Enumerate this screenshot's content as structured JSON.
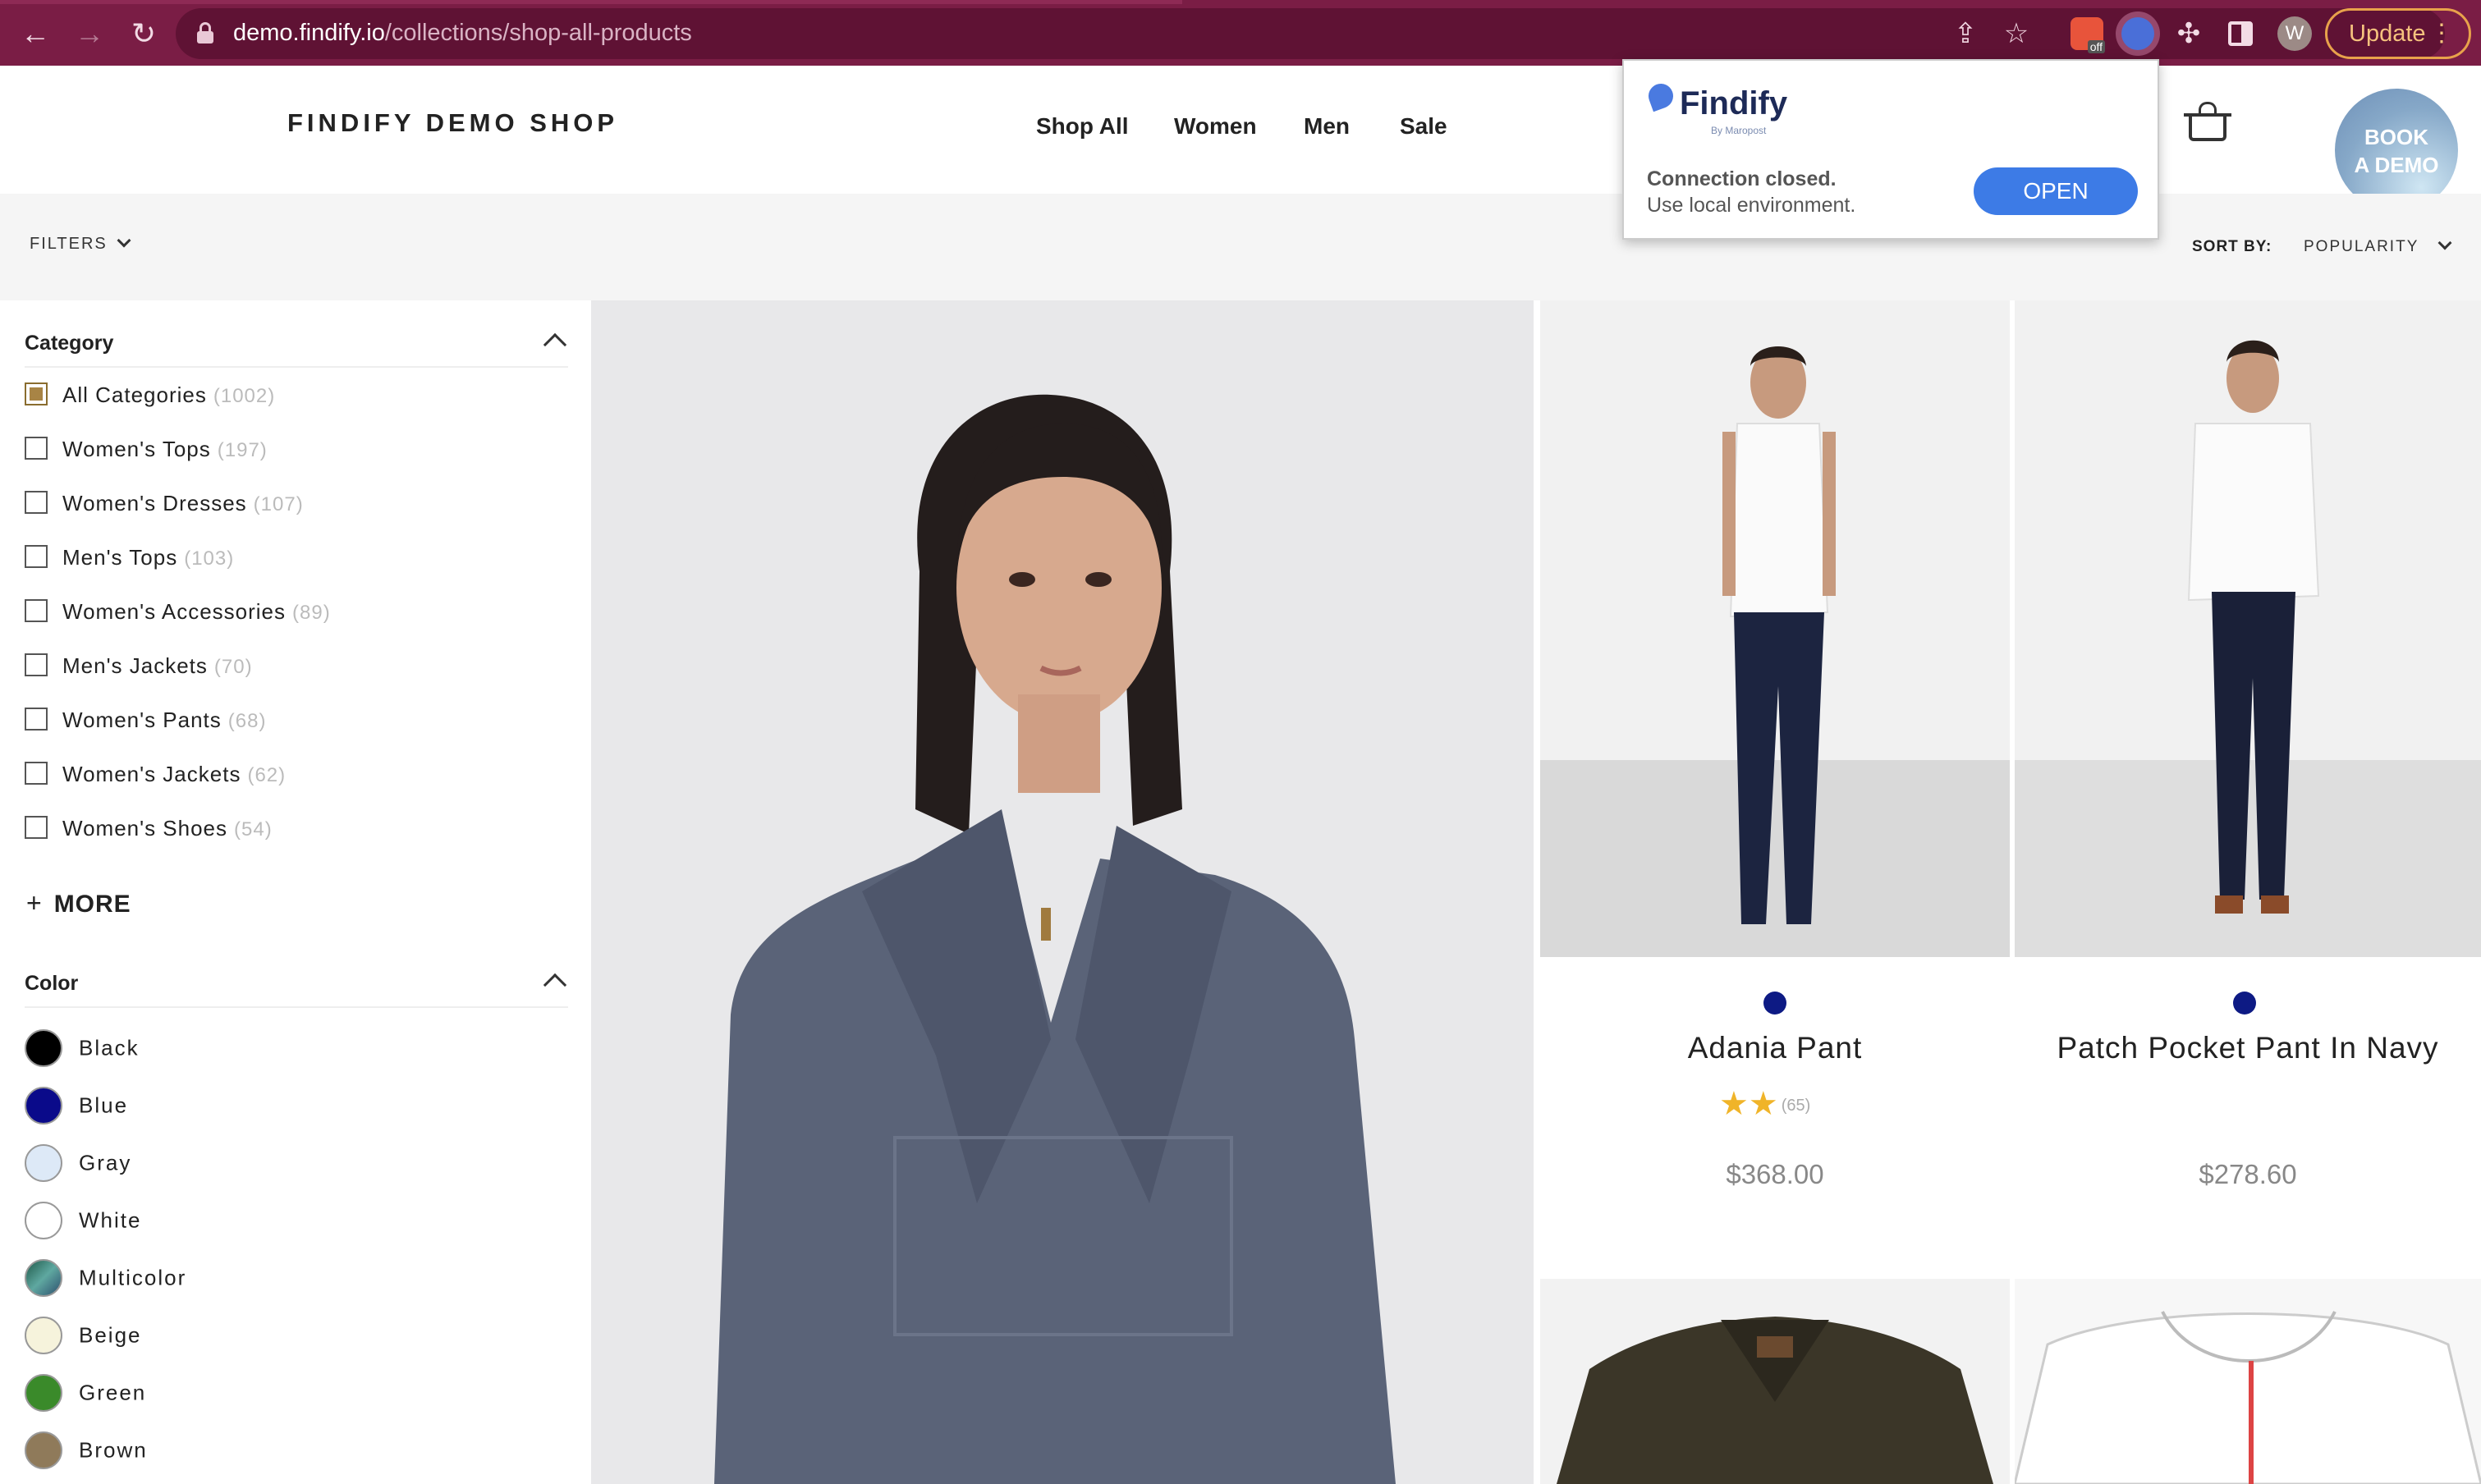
{
  "browser": {
    "url_host": "demo.findify.io",
    "url_path": "/collections/shop-all-products",
    "avatar_letter": "W",
    "update_label": "Update",
    "ext_off_badge": "off",
    "icons": [
      "back-icon",
      "forward-icon",
      "reload-icon",
      "lock-icon",
      "share-icon",
      "star-icon",
      "puzzle-icon",
      "side-panel-icon",
      "kebab-menu-icon"
    ]
  },
  "header": {
    "logo": "FINDIFY DEMO SHOP",
    "nav": [
      "Shop All",
      "Women",
      "Men",
      "Sale"
    ],
    "book_demo_line1": "BOOK",
    "book_demo_line2": "A DEMO"
  },
  "toolbar": {
    "filters_label": "FILTERS",
    "sort_label": "SORT BY:",
    "sort_value": "POPULARITY"
  },
  "popup": {
    "brand": "Findify",
    "brand_sub": "By Maropost",
    "message_title": "Connection closed.",
    "message_body": "Use local environment.",
    "open_label": "OPEN"
  },
  "filters": {
    "category_title": "Category",
    "categories": [
      {
        "label": "All Categories",
        "count": "(1002)",
        "checked": true
      },
      {
        "label": "Women's Tops",
        "count": "(197)",
        "checked": false
      },
      {
        "label": "Women's Dresses",
        "count": "(107)",
        "checked": false
      },
      {
        "label": "Men's Tops",
        "count": "(103)",
        "checked": false
      },
      {
        "label": "Women's Accessories",
        "count": "(89)",
        "checked": false
      },
      {
        "label": "Men's Jackets",
        "count": "(70)",
        "checked": false
      },
      {
        "label": "Women's Pants",
        "count": "(68)",
        "checked": false
      },
      {
        "label": "Women's Jackets",
        "count": "(62)",
        "checked": false
      },
      {
        "label": "Women's Shoes",
        "count": "(54)",
        "checked": false
      }
    ],
    "more_label": "MORE",
    "color_title": "Color",
    "colors": [
      {
        "label": "Black",
        "hex": "#000000"
      },
      {
        "label": "Blue",
        "hex": "#0a0a8a"
      },
      {
        "label": "Gray",
        "hex": "#dde9f7"
      },
      {
        "label": "White",
        "hex": "#ffffff"
      },
      {
        "label": "Multicolor",
        "hex": "#2f6e5c"
      },
      {
        "label": "Beige",
        "hex": "#f6f3dc"
      },
      {
        "label": "Green",
        "hex": "#3a8a2a"
      },
      {
        "label": "Brown",
        "hex": "#8f7a5a"
      }
    ]
  },
  "products": [
    {
      "title": "Adania Pant",
      "rating_stars": 2,
      "rating_count": "(65)",
      "price": "$368.00",
      "swatch": "#0d1a84"
    },
    {
      "title": "Patch Pocket Pant In Navy",
      "rating_stars": 0,
      "rating_count": "",
      "price": "$278.60",
      "swatch": "#0d1a84"
    }
  ],
  "colors": {
    "chrome": "#7a1d45",
    "accent_button": "#3d7be6",
    "checkbox_checked": "#a88445",
    "star": "#f0b429"
  }
}
